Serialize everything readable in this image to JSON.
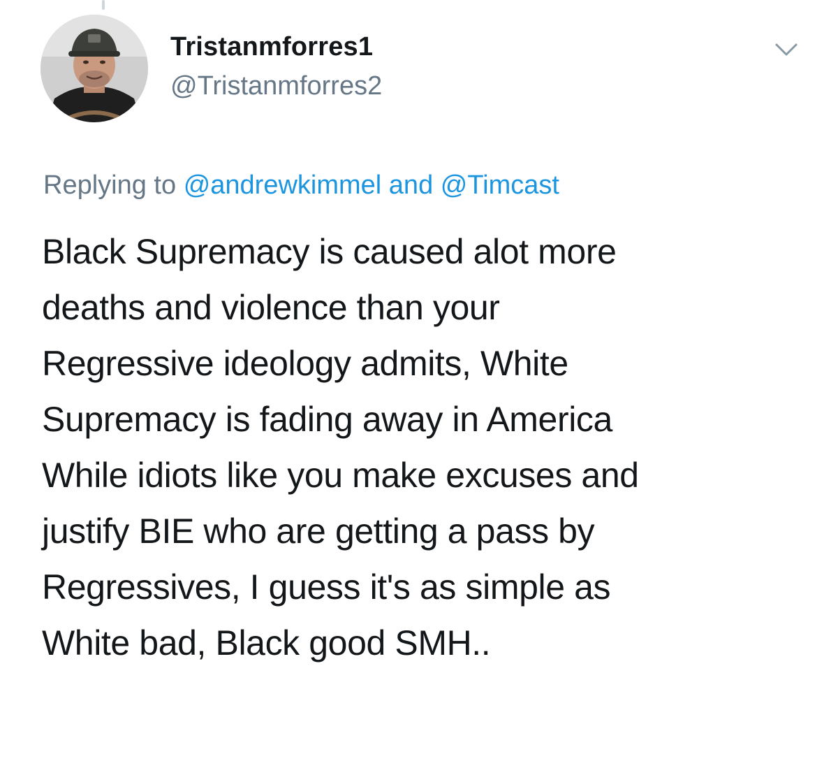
{
  "author": {
    "display_name": "Tristanmforres1",
    "handle": "@Tristanmforres2",
    "avatar_icon": "user-photo-avatar"
  },
  "menu": {
    "icon": "chevron-down-icon"
  },
  "reply_context": {
    "prefix": "Replying to",
    "mention_1": "@andrewkimmel",
    "conjunction": "and",
    "mention_2": "@Timcast"
  },
  "tweet": {
    "lines": [
      "Black Supremacy is caused alot more",
      "deaths and violence than your",
      "Regressive ideology admits, White",
      "Supremacy is fading away in America",
      "While idiots like you make excuses and",
      "justify BIE who are getting a pass by",
      "Regressives, I guess it's as simple as",
      "White bad, Black good SMH.."
    ]
  },
  "colors": {
    "primary_text": "#14171a",
    "secondary_text": "#657786",
    "link": "#1b95e0",
    "thread_line": "#ccd6dd"
  }
}
